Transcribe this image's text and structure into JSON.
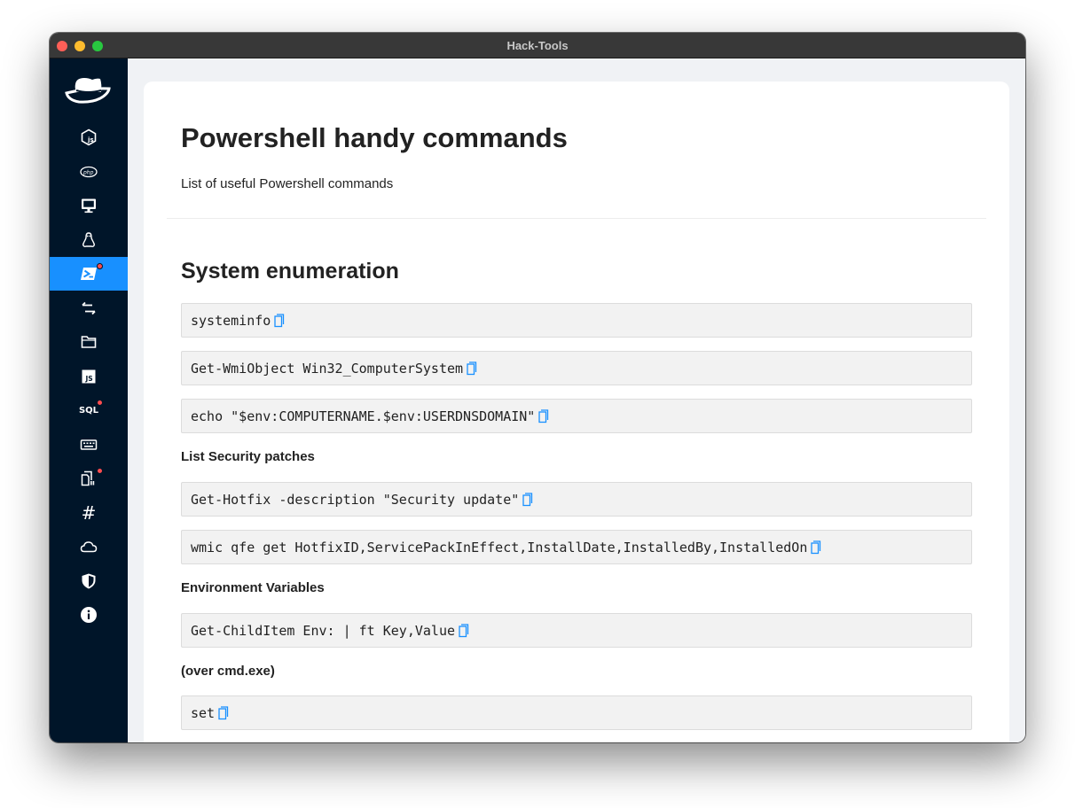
{
  "window": {
    "title": "Hack-Tools"
  },
  "sidebar": {
    "items": [
      {
        "icon": "nodejs-icon",
        "label": ""
      },
      {
        "icon": "php-icon",
        "label": ""
      },
      {
        "icon": "desktop-icon",
        "label": ""
      },
      {
        "icon": "linux-icon",
        "label": ""
      },
      {
        "icon": "powershell-icon",
        "label": "",
        "active": true,
        "badge": true
      },
      {
        "icon": "transfer-icon",
        "label": ""
      },
      {
        "icon": "folder-icon",
        "label": ""
      },
      {
        "icon": "javascript-icon",
        "label": ""
      },
      {
        "icon": "sql-icon",
        "label": "SQL",
        "badge": true
      },
      {
        "icon": "keyboard-icon",
        "label": ""
      },
      {
        "icon": "file-copy-icon",
        "label": "",
        "badge": true
      },
      {
        "icon": "hash-icon",
        "label": "#"
      },
      {
        "icon": "cloud-icon",
        "label": ""
      },
      {
        "icon": "shield-icon",
        "label": ""
      },
      {
        "icon": "info-icon",
        "label": ""
      }
    ]
  },
  "page": {
    "title": "Powershell handy commands",
    "description": "List of useful Powershell commands",
    "section_title": "System enumeration",
    "commands": [
      "systeminfo",
      "Get-WmiObject Win32_ComputerSystem",
      "echo \"$env:COMPUTERNAME.$env:USERDNSDOMAIN\"",
      "Get-Hotfix -description \"Security update\"",
      "wmic qfe get HotfixID,ServicePackInEffect,InstallDate,InstalledBy,InstalledOn",
      "Get-ChildItem Env: | ft Key,Value",
      "set"
    ],
    "subheadings": [
      "List Security patches",
      "Environment Variables",
      "(over cmd.exe)"
    ]
  },
  "colors": {
    "sidebar_bg": "#001529",
    "accent": "#1890ff",
    "badge": "#ff4d4f"
  }
}
